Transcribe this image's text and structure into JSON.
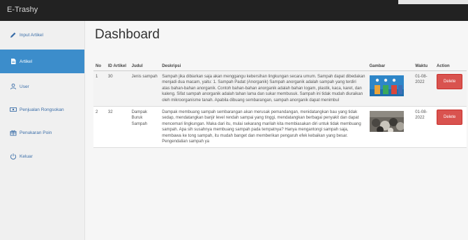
{
  "app": {
    "brand": "E-Trashy"
  },
  "sidebar": {
    "items": [
      {
        "label": "Input Artikel",
        "icon": "pencil-icon",
        "active": false
      },
      {
        "label": "Artikel",
        "icon": "document-icon",
        "active": true
      },
      {
        "label": "User",
        "icon": "user-icon",
        "active": false
      },
      {
        "label": "Penjualan Rongsokan",
        "icon": "money-icon",
        "active": false
      },
      {
        "label": "Penukaran Poin",
        "icon": "gift-icon",
        "active": false
      },
      {
        "label": "Keluar",
        "icon": "power-icon",
        "active": false
      }
    ]
  },
  "main": {
    "title": "Dashboard",
    "table": {
      "headers": {
        "no": "No",
        "id": "ID Artikel",
        "judul": "Judul",
        "deskripsi": "Deskripsi",
        "gambar": "Gambar",
        "waktu": "Waktu",
        "action": "Action"
      },
      "rows": [
        {
          "no": "1",
          "id": "30",
          "judul": "Jenis sampah",
          "deskripsi": "Sampah jika dibiarkan saja akan menggangu kebersihan lingkungan secara umum. Sampah dapat dibedakan menjadi dua macam, yaitu: 1. Sampah Padat (Anorganik) Sampah anorganik adalah sampah yang terdiri atas bahan-bahan anorganik. Contoh bahan-bahan anorganik adalah bahan logam, plastik, kaca, karet, dan kaleng. Sifat sampah anorganik adalah tahan lama dan sukar membusuk. Sampah ini tidak mudah diuraikan oleh mikroorganisme tanah. Apabila dibuang sembarangan, sampah anorganik dapat menimbul",
          "waktu": "01-08-2022",
          "action": "Delete"
        },
        {
          "no": "2",
          "id": "32",
          "judul": "Dampak Buruk Sampah",
          "deskripsi": "Dampak membuang sampah sembarangan akan merusak pemandangan, menidatangkan bau yang tidak sedap, mendatangkan banjir level rendah sampai yang tinggi, mendatangkan berbagai penyakit dan dapat mencemari lingkungan. Maka dari itu, mulai sekarang marilah kita membiasakan diri untuk tidak membuang sampah. Apa sih susahnya membuang sampah pada tempatnya? Hanya mengantongi sampah saja, membawa ke tong sampah, itu mudah banget dan memberikan pengaruh efek kebaikan yang besar. Pengendalian sampah ya",
          "waktu": "01-08-2022",
          "action": "Delete"
        }
      ]
    }
  }
}
